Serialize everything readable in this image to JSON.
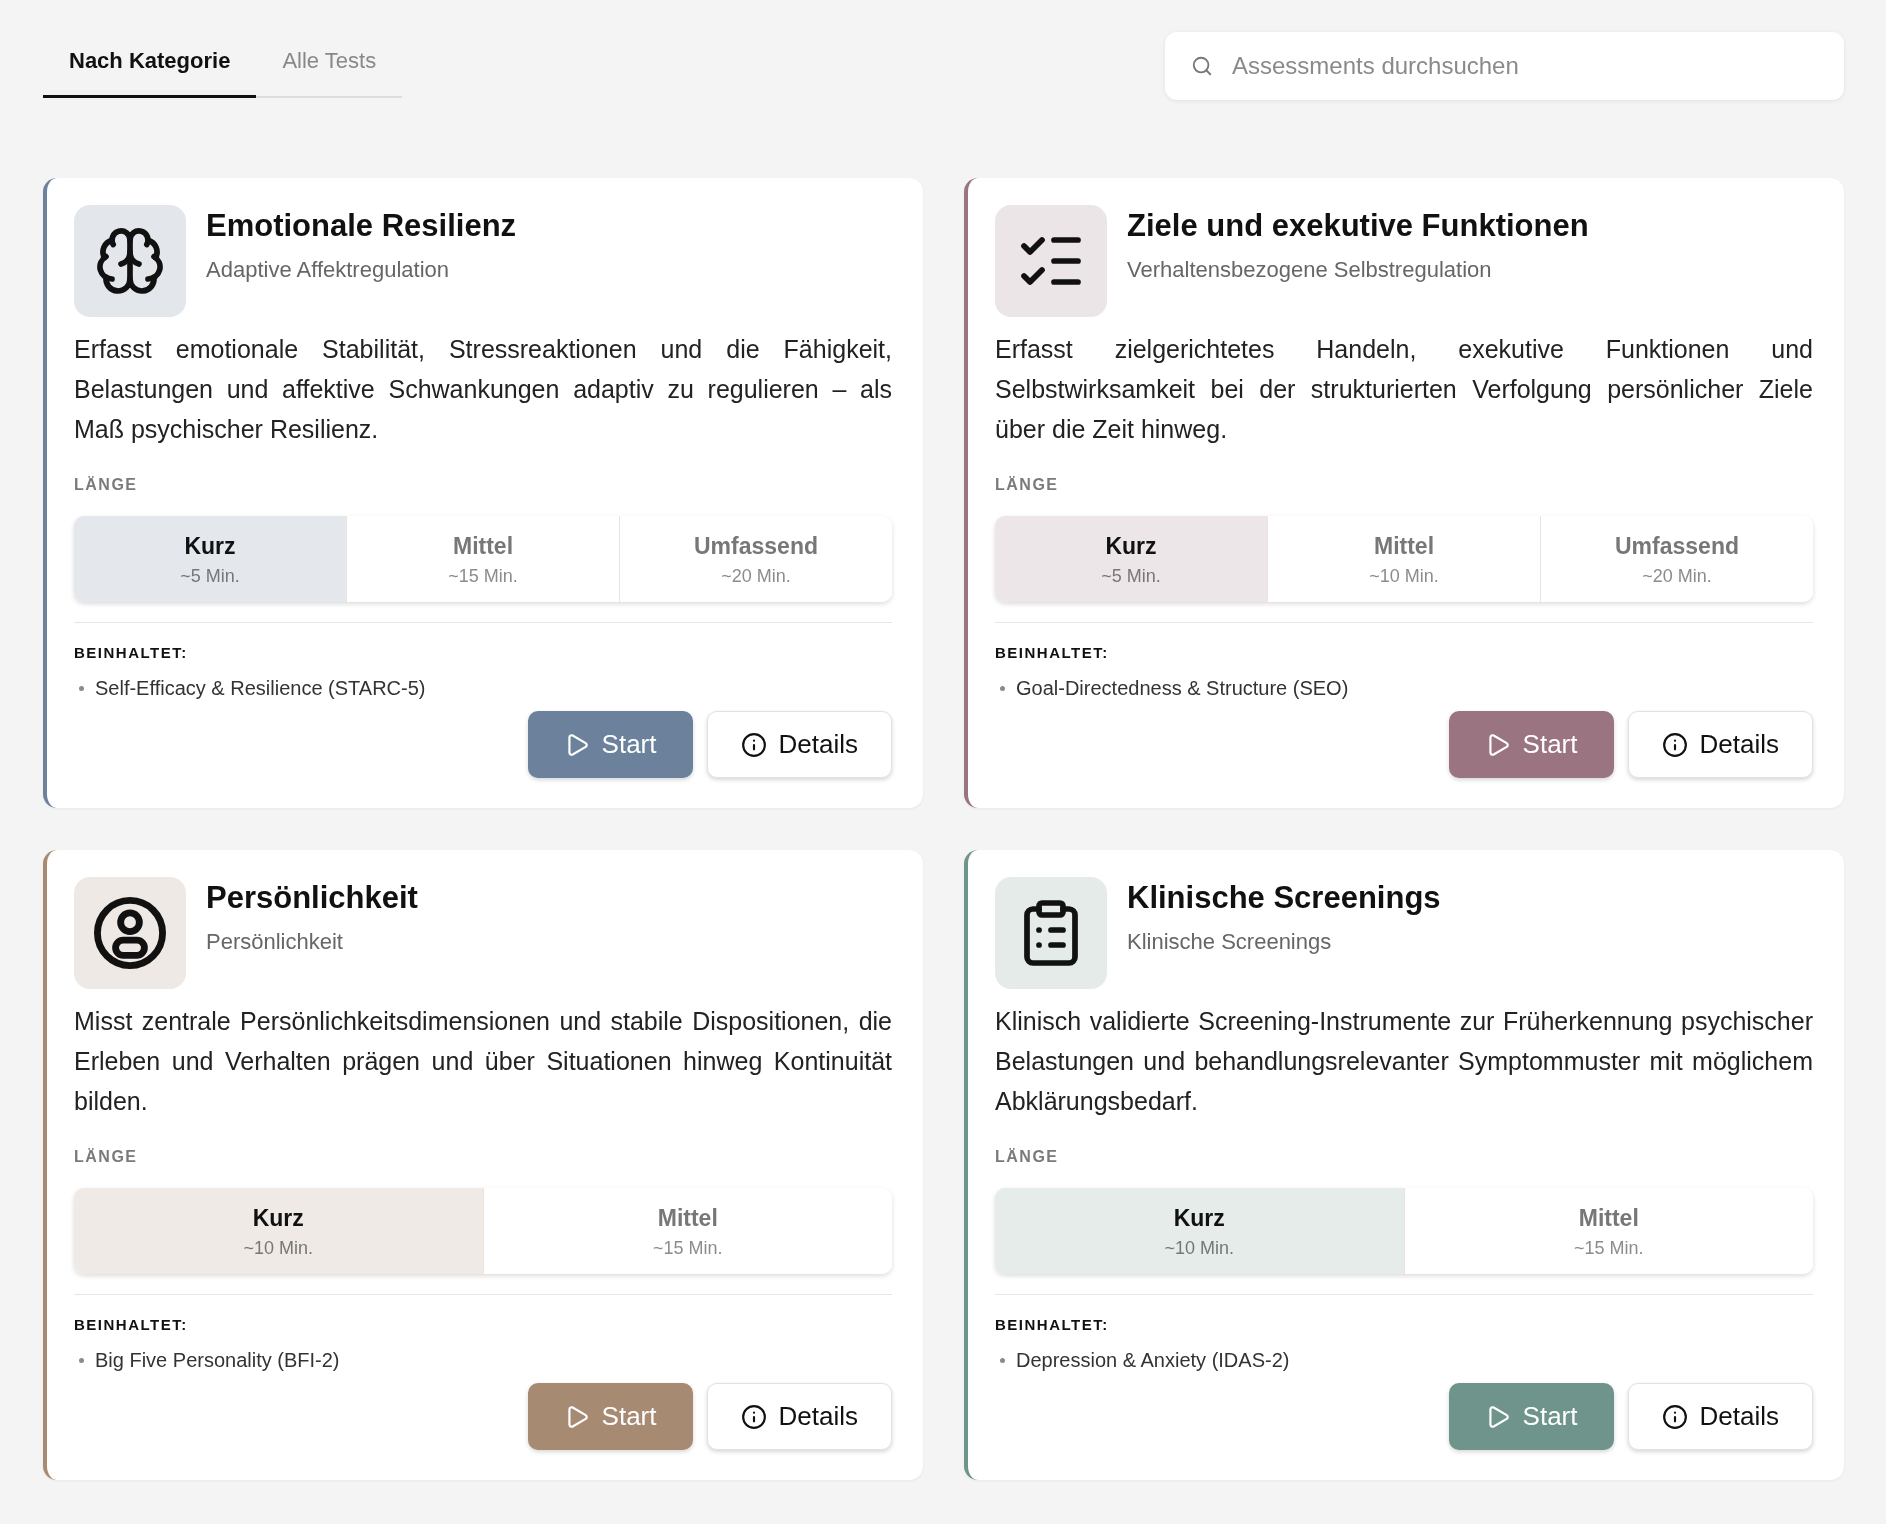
{
  "tabs": [
    {
      "label": "Nach Kategorie",
      "selected": true
    },
    {
      "label": "Alle Tests",
      "selected": false
    }
  ],
  "search": {
    "placeholder": "Assessments durchsuchen"
  },
  "categories": [
    {
      "title": "Emotionale Resilienz",
      "subtitle": "Adaptive Affektregulation",
      "color": "#6b819c",
      "description": "Erfasst emotionale Stabilität, Stressreaktionen und die Fähigkeit, Belastungen und affektive Schwankungen adaptiv zu regulieren – als Maß psychischer Resilienz.",
      "length_label": "LÄNGE",
      "lengths": [
        {
          "label": "Kurz",
          "duration": "~5 Min.",
          "selected": true
        },
        {
          "label": "Mittel",
          "duration": "~15 Min.",
          "selected": false
        },
        {
          "label": "Umfassend",
          "duration": "~20 Min.",
          "selected": false
        }
      ],
      "includes_label": "BEINHALTET:",
      "includes": [
        "Self-Efficacy & Resilience (STARC-5)"
      ],
      "buttons": [
        {
          "kind": "primary",
          "label": "Start"
        },
        {
          "kind": "secondary",
          "label": "Details"
        }
      ]
    },
    {
      "title": "Ziele und exekutive Funktionen",
      "subtitle": "Verhaltensbezogene Selbstregulation",
      "color": "#9a7480",
      "description": "Erfasst zielgerichtetes Handeln, exekutive Funktionen und Selbstwirksamkeit bei der strukturierten Verfolgung persönlicher Ziele über die Zeit hinweg.",
      "length_label": "LÄNGE",
      "lengths": [
        {
          "label": "Kurz",
          "duration": "~5 Min.",
          "selected": true
        },
        {
          "label": "Mittel",
          "duration": "~10 Min.",
          "selected": false
        },
        {
          "label": "Umfassend",
          "duration": "~20 Min.",
          "selected": false
        }
      ],
      "includes_label": "BEINHALTET:",
      "includes": [
        "Goal-Directedness & Structure (SEO)"
      ],
      "buttons": [
        {
          "kind": "primary",
          "label": "Start"
        },
        {
          "kind": "secondary",
          "label": "Details"
        }
      ]
    },
    {
      "title": "Persönlichkeit",
      "subtitle": "Persönlichkeit",
      "color": "#a68a72",
      "description": "Misst zentrale Persönlichkeitsdimensionen und stabile Dispositionen, die Erleben und Verhalten prägen und über Situationen hinweg Kontinuität bilden.",
      "length_label": "LÄNGE",
      "lengths": [
        {
          "label": "Kurz",
          "duration": "~10 Min.",
          "selected": true
        },
        {
          "label": "Mittel",
          "duration": "~15 Min.",
          "selected": false
        }
      ],
      "includes_label": "BEINHALTET:",
      "includes": [
        "Big Five Personality (BFI-2)"
      ],
      "buttons": [
        {
          "kind": "primary",
          "label": "Start"
        },
        {
          "kind": "secondary",
          "label": "Details"
        }
      ]
    },
    {
      "title": "Klinische Screenings",
      "subtitle": "Klinische Screenings",
      "color": "#6f948b",
      "description": "Klinisch validierte Screening-Instrumente zur Früherkennung psychischer Belastungen und behandlungsrelevanter Symptommuster mit möglichem Abklärungsbedarf.",
      "length_label": "LÄNGE",
      "lengths": [
        {
          "label": "Kurz",
          "duration": "~10 Min.",
          "selected": true
        },
        {
          "label": "Mittel",
          "duration": "~15 Min.",
          "selected": false
        }
      ],
      "includes_label": "BEINHALTET:",
      "includes": [
        "Depression & Anxiety (IDAS-2)"
      ],
      "buttons": [
        {
          "kind": "primary",
          "label": "Start"
        },
        {
          "kind": "secondary",
          "label": "Details"
        }
      ]
    }
  ]
}
